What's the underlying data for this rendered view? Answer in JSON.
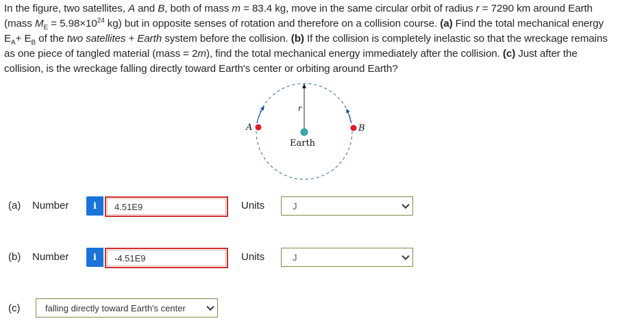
{
  "problem": {
    "t1": "In the figure, two satellites, ",
    "A": "A",
    "t2": " and ",
    "B": "B",
    "t3": ", both of mass ",
    "m": "m",
    "t4": " = 83.4 kg, move in the same circular orbit of radius ",
    "r": "r",
    "t5": " = 7290 km around Earth (mass ",
    "M": "M",
    "Esub": "E",
    "t6": " = 5.98×10",
    "exp": "24",
    "t7": " kg) but in opposite senses of rotation and therefore on a collision course. ",
    "pa": "(a)",
    "t8": " Find the total mechanical energy E",
    "Asub": "A",
    "t9": "+ E",
    "Bsub": "B",
    "t10": " of the ",
    "sys": "two satellites + Earth",
    "t11": " system before the collision. ",
    "pb": "(b)",
    "t12": " If the collision is completely inelastic so that the wreckage remains as one piece of tangled material (mass = 2",
    "m2": "m",
    "t13": "), find the total mechanical energy immediately after the collision. ",
    "pc": "(c)",
    "t14": " Just after the collision, is the wreckage falling directly toward Earth's center or orbiting around Earth?"
  },
  "figure": {
    "label_A": "A",
    "label_B": "B",
    "label_r": "r",
    "label_earth": "Earth",
    "color_satellite": "#e01b24",
    "color_earth": "#3aa9b4"
  },
  "part_a": {
    "label": "(a)",
    "number_label": "Number",
    "info_icon": "i",
    "value": "4.51E9",
    "units_label": "Units",
    "unit_value": "J"
  },
  "part_b": {
    "label": "(b)",
    "number_label": "Number",
    "info_icon": "i",
    "value": "-4.51E9",
    "units_label": "Units",
    "unit_value": "J"
  },
  "part_c": {
    "label": "(c)",
    "answer": "falling directly toward Earth's center"
  },
  "colors": {
    "info_button": "#1a73d9",
    "invalid_border": "#c9302c",
    "select_border": "#7a8f47"
  }
}
